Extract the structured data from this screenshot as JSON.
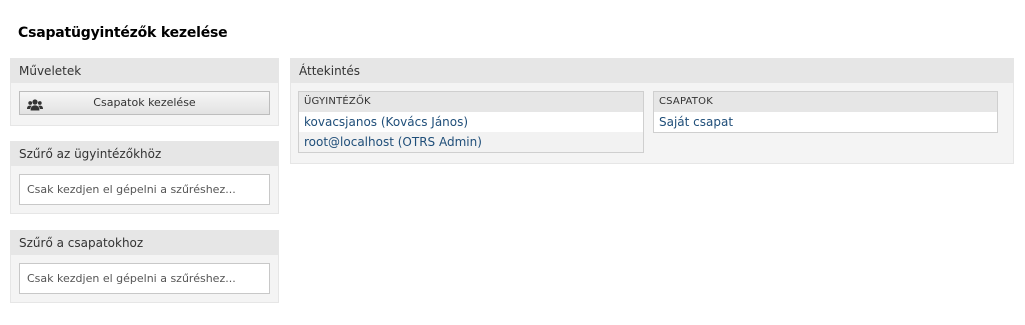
{
  "page": {
    "title": "Csapatügyintézők kezelése"
  },
  "actions": {
    "header": "Műveletek",
    "manage_groups_label": "Csapatok kezelése",
    "manage_groups_icon": "users-icon"
  },
  "filter_agents": {
    "header": "Szűrő az ügyintézőkhöz",
    "placeholder": "Csak kezdjen el gépelni a szűréshez..."
  },
  "filter_groups": {
    "header": "Szűrő a csapatokhoz",
    "placeholder": "Csak kezdjen el gépelni a szűréshez..."
  },
  "overview": {
    "header": "Áttekintés",
    "agents": {
      "column_header": "ÜGYINTÉZŐK",
      "rows": [
        "kovacsjanos (Kovács János)",
        "root@localhost (OTRS Admin)"
      ]
    },
    "groups": {
      "column_header": "CSAPATOK",
      "rows": [
        "Saját csapat"
      ]
    }
  },
  "colors": {
    "link": "#1f4e79",
    "header_bg": "#e6e6e6",
    "panel_bg": "#f4f4f4"
  }
}
